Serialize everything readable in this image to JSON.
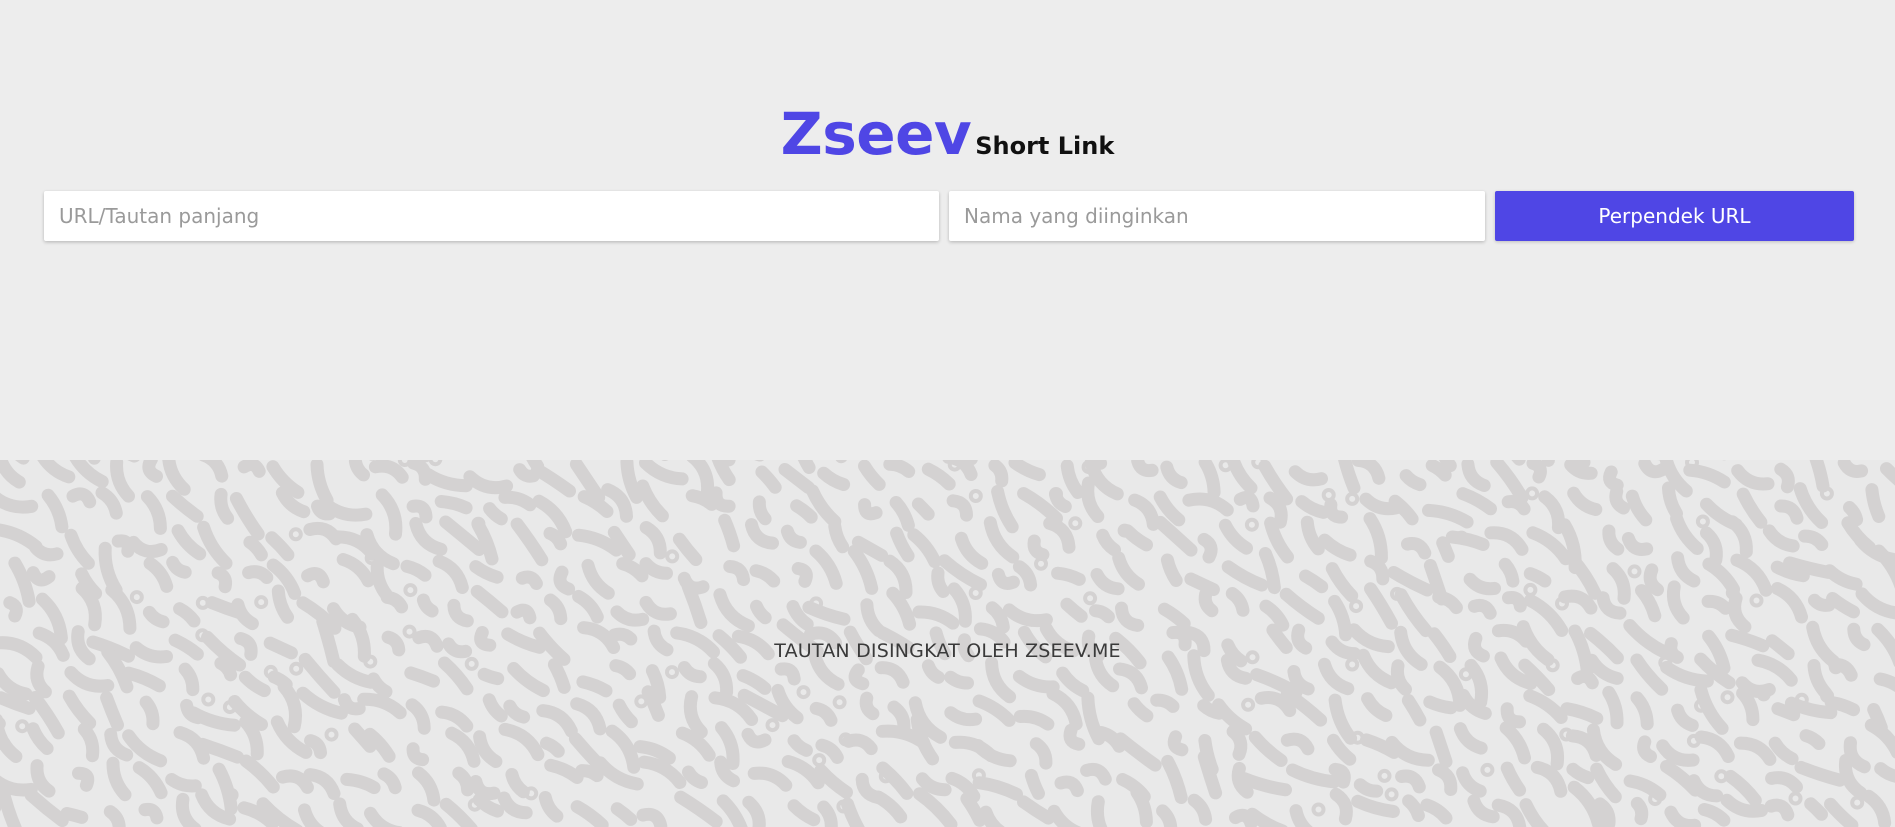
{
  "brand": {
    "name": "Zseev",
    "subtitle": "Short Link"
  },
  "form": {
    "url_placeholder": "URL/Tautan panjang",
    "name_placeholder": "Nama yang diinginkan",
    "submit_label": "Perpendek URL"
  },
  "footer": {
    "text": "TAUTAN DISINGKAT OLEH ZSEEV.ME"
  },
  "colors": {
    "accent": "#4f46e5",
    "background": "#ededed",
    "pattern_light": "#e9e9e9",
    "pattern_dark": "#d4d2d2"
  }
}
